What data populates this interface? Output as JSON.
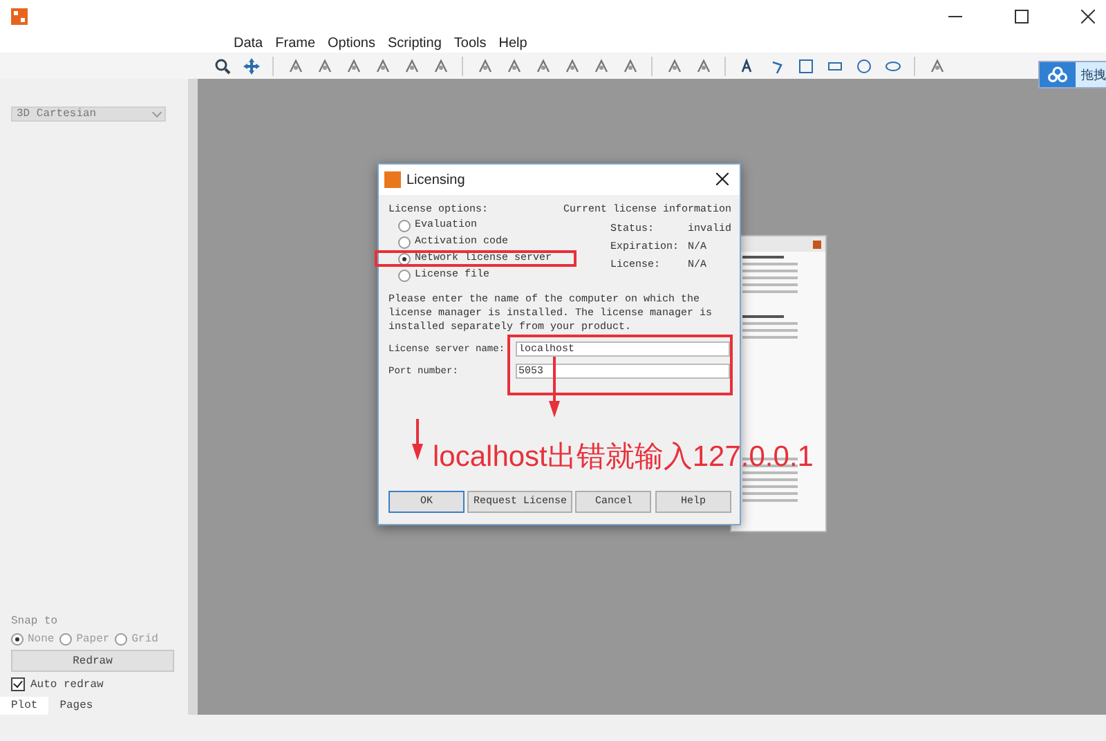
{
  "menu": [
    "Data",
    "Frame",
    "Options",
    "Scripting",
    "Tools",
    "Help"
  ],
  "left_panel": {
    "plot_type": "3D Cartesian",
    "snap_label": "Snap to",
    "snap_options": [
      {
        "label": "None",
        "selected": true
      },
      {
        "label": "Paper",
        "selected": false
      },
      {
        "label": "Grid",
        "selected": false
      }
    ],
    "redraw_button": "Redraw",
    "auto_redraw": {
      "label": "Auto redraw",
      "checked": true
    },
    "tabs": [
      {
        "label": "Plot",
        "selected": true
      },
      {
        "label": "Pages",
        "selected": false
      }
    ]
  },
  "side_widget": {
    "label": "拖拽"
  },
  "dialog": {
    "title": "Licensing",
    "options_label": "License options:",
    "options": [
      {
        "label": "Evaluation",
        "selected": false
      },
      {
        "label": "Activation code",
        "selected": false
      },
      {
        "label": "Network license server",
        "selected": true
      },
      {
        "label": "License file",
        "selected": false
      }
    ],
    "info_title": "Current license information",
    "info": [
      {
        "label": "Status:",
        "value": "invalid"
      },
      {
        "label": "Expiration:",
        "value": "N/A"
      },
      {
        "label": "License:",
        "value": "N/A"
      }
    ],
    "description": "Please enter the name of the computer on which the license manager is installed. The license manager is installed separately from your product.",
    "fields": [
      {
        "label": "License server name:",
        "value": "localhost"
      },
      {
        "label": "Port number:",
        "value": "5053"
      }
    ],
    "buttons": [
      "OK",
      "Request License",
      "Cancel",
      "Help"
    ]
  },
  "annotation": {
    "text": "localhost出错就输入127.0.0.1"
  }
}
